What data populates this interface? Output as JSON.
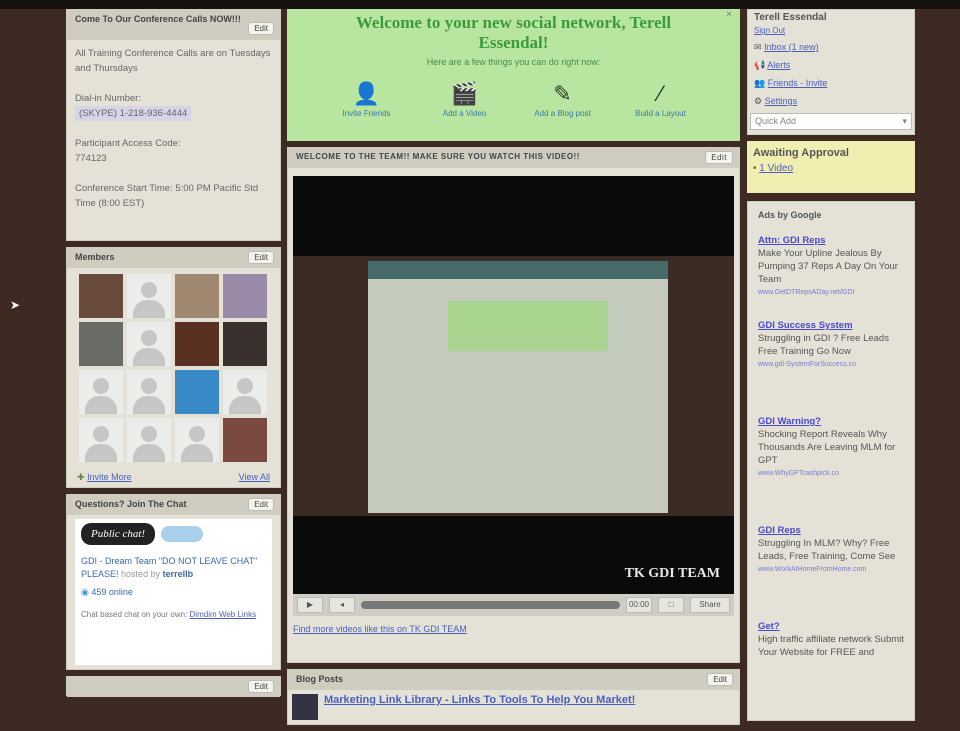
{
  "conference": {
    "title": "Come To Our Conference Calls NOW!!!",
    "edit": "Edit",
    "lines": [
      "All Training Conference Calls are on Tuesdays and Thursdays",
      "Dial-in Number:",
      "(SKYPE) 1-218-936-4444",
      "Participant Access Code:",
      "774123",
      "Conference Start Time: 5:00 PM Pacific Std Time (8:00 EST)"
    ]
  },
  "members": {
    "title": "Members",
    "edit": "Edit",
    "invite": "Invite More",
    "view_all": "View All"
  },
  "chat": {
    "title": "Questions? Join The Chat",
    "edit": "Edit",
    "bubble": "Public chat!",
    "room": "GDI - Dream Team \"DO NOT LEAVE CHAT\" PLEASE!",
    "hosted": "hosted by",
    "host": "terrellb",
    "online": "459 online",
    "footer": "Chat based chat on your own:",
    "footer_link": "Dimdim Web Links"
  },
  "welcome": {
    "title": "Welcome to your new social network, Terell Essendal!",
    "sub": "Here are a few things you can do right now:",
    "close": "×",
    "actions": [
      {
        "icon": "person-icon",
        "label": "Invite Friends"
      },
      {
        "icon": "clapper-icon",
        "label": "Add a Video"
      },
      {
        "icon": "pencil-icon",
        "label": "Add a Blog post"
      },
      {
        "icon": "wand-icon",
        "label": "Build a Layout"
      }
    ]
  },
  "video_section": {
    "title": "WELCOME TO THE TEAM!! MAKE SURE YOU WATCH THIS VIDEO!!",
    "edit": "Edit",
    "overlay": "TK GDI TEAM",
    "time": "00:00",
    "share": "Share",
    "more_link": "Find more videos like this on TK GDI TEAM"
  },
  "blog": {
    "title": "Blog Posts",
    "edit": "Edit",
    "post": "Marketing Link Library - Links To Tools To Help You Market!"
  },
  "user": {
    "name": "Terell Essendal",
    "sign_out": "Sign Out",
    "links": [
      "Inbox (1 new)",
      "Alerts",
      "Friends - Invite",
      "Settings"
    ],
    "quick_add": "Quick Add"
  },
  "approval": {
    "title": "Awaiting Approval",
    "item": "1 Video"
  },
  "ads": {
    "label": "Ads by Google",
    "items": [
      {
        "title": "Attn: GDI Reps",
        "body": "Make Your Upline Jealous By Pumping 37 Reps A Day On Your Team",
        "url": "www.GetDTRepsADay.net/GDI"
      },
      {
        "title": "GDI Success System",
        "body": "Struggling in GDI ? Free Leads Free Training Go Now",
        "url": "www.gdi-SystemForSuccess.co"
      },
      {
        "title": "GDI Warning?",
        "body": "Shocking Report Reveals Why Thousands Are Leaving MLM for GPT",
        "url": "www.WhyGPTcashpick.co"
      },
      {
        "title": "GDI Reps",
        "body": "Struggling In MLM? Why? Free Leads, Free Training, Come See",
        "url": "www.WorkAtHomeFromHome.com"
      },
      {
        "title": "Get?",
        "body": "High traffic affiliate network Submit Your Website for FREE and",
        "url": ""
      }
    ]
  }
}
